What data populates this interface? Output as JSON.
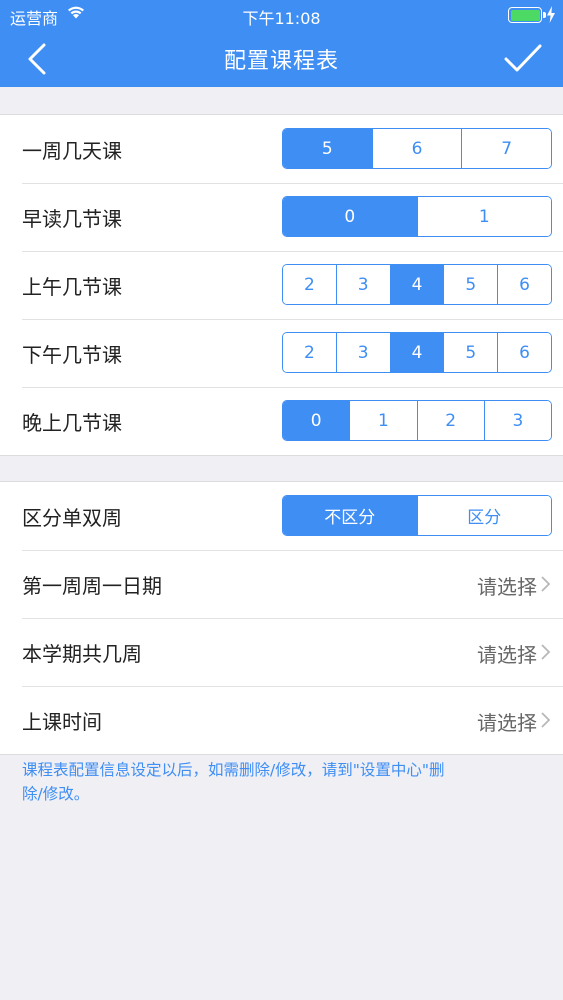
{
  "status_bar": {
    "carrier": "运营商",
    "time": "下午11:08"
  },
  "nav": {
    "title": "配置课程表"
  },
  "rows": {
    "days_per_week": {
      "label": "一周几天课",
      "options": [
        "5",
        "6",
        "7"
      ],
      "selected": "5"
    },
    "morning_reading": {
      "label": "早读几节课",
      "options": [
        "0",
        "1"
      ],
      "selected": "0"
    },
    "morning_classes": {
      "label": "上午几节课",
      "options": [
        "2",
        "3",
        "4",
        "5",
        "6"
      ],
      "selected": "4"
    },
    "afternoon_classes": {
      "label": "下午几节课",
      "options": [
        "2",
        "3",
        "4",
        "5",
        "6"
      ],
      "selected": "4"
    },
    "evening_classes": {
      "label": "晚上几节课",
      "options": [
        "0",
        "1",
        "2",
        "3"
      ],
      "selected": "0"
    },
    "odd_even_week": {
      "label": "区分单双周",
      "options": [
        "不区分",
        "区分"
      ],
      "selected": "不区分"
    },
    "first_monday": {
      "label": "第一周周一日期",
      "value": "请选择"
    },
    "total_weeks": {
      "label": "本学期共几周",
      "value": "请选择"
    },
    "class_time": {
      "label": "上课时间",
      "value": "请选择"
    }
  },
  "note": "课程表配置信息设定以后，如需删除/修改，请到\"设置中心\"删除/修改。",
  "colors": {
    "accent": "#3e8ef4",
    "background": "#efeff4"
  }
}
